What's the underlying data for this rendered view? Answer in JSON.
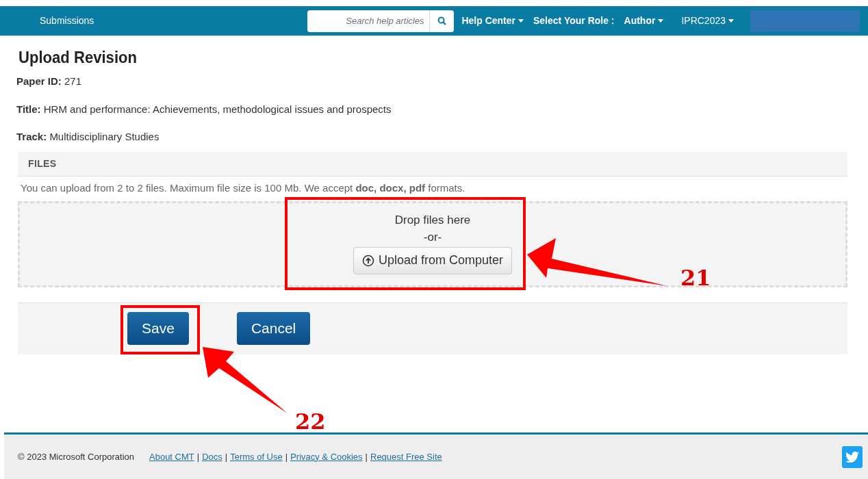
{
  "nav": {
    "brand": "Submissions",
    "search": {
      "placeholder": "Search help articles"
    },
    "menus": [
      {
        "label": "Help Center",
        "kind": "dropdown"
      },
      {
        "label": "Select Your Role :",
        "kind": "label"
      },
      {
        "label": "Author",
        "kind": "dropdown"
      },
      {
        "label": "IPRC2023",
        "kind": "dropdown"
      }
    ]
  },
  "page": {
    "title": "Upload Revision",
    "fields": [
      {
        "label": "Paper ID:",
        "value": "271"
      },
      {
        "label": "Title:",
        "value": "HRM and performance: Achievements, methodological issues and prospects"
      },
      {
        "label": "Track:",
        "value": "Multidisciplinary Studies"
      }
    ]
  },
  "files": {
    "heading": "FILES",
    "hint": "You can upload from 2 to 2 files. Maximum file size is 100 Mb. We accept **doc, docx, pdf** formats.",
    "drop_text": "Drop files here",
    "or_text": "-or-",
    "upload_button": "Upload from Computer"
  },
  "actions": [
    {
      "label": "Save"
    },
    {
      "label": "Cancel"
    }
  ],
  "callouts": [
    {
      "number": "21"
    },
    {
      "number": "22"
    }
  ],
  "footer": {
    "copyright": "© 2023 Microsoft Corporation",
    "separator": "|",
    "links": [
      "About CMT",
      "Docs",
      "Terms of Use",
      "Privacy & Cookies",
      "Request Free Site"
    ]
  }
}
